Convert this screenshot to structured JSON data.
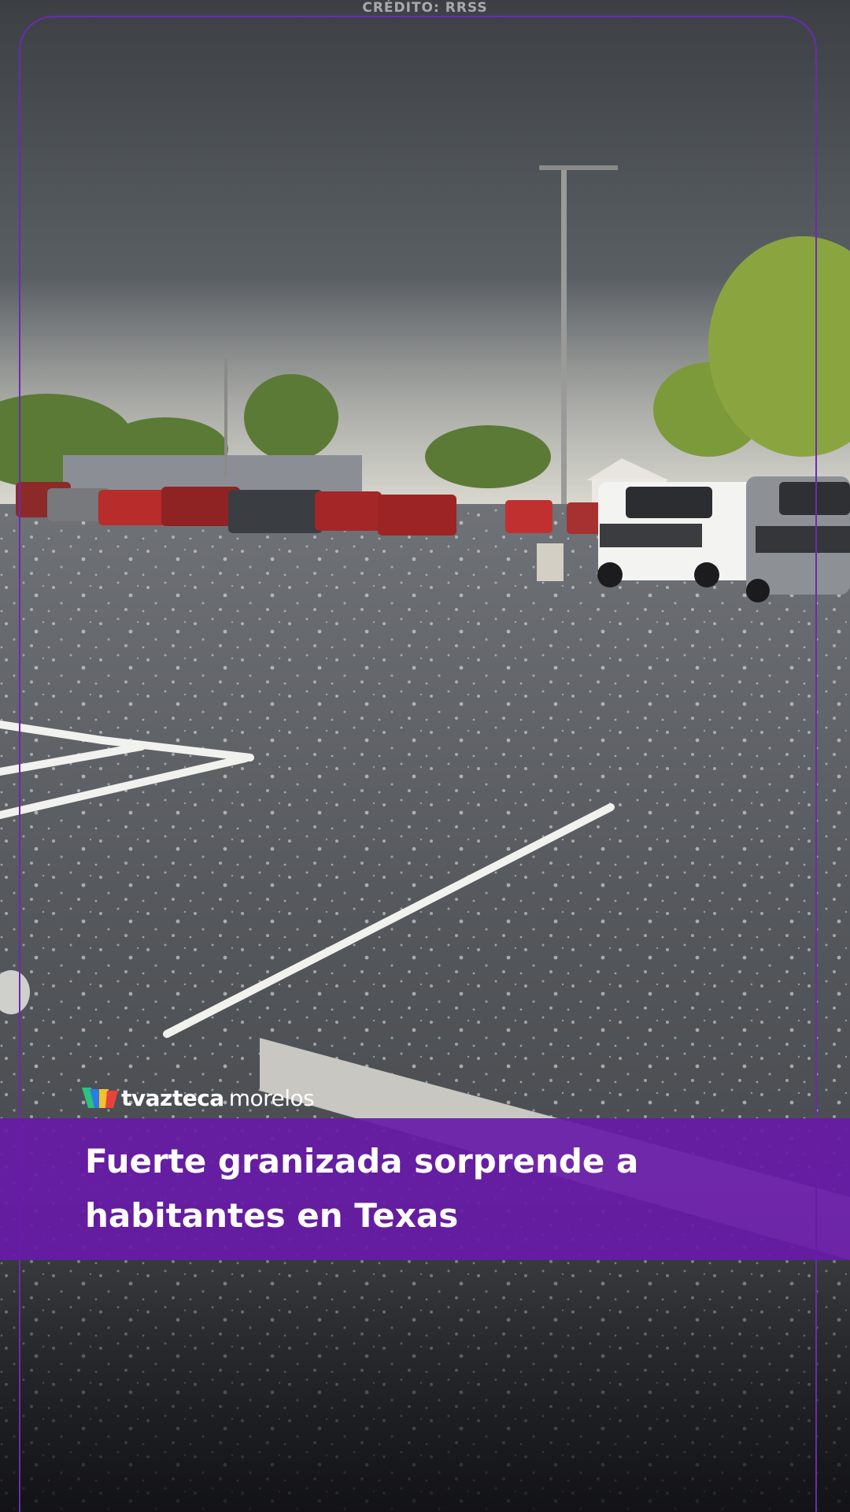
{
  "credit": "CRÉDITO: RRSS",
  "logo": {
    "brand": "tvazteca",
    "region": "morelos",
    "mark_icon": "tv-azteca-logo-mark",
    "colors": [
      "#2ec27e",
      "#2a7de1",
      "#f2c230",
      "#e8423a"
    ]
  },
  "headline": "Fuerte granizada sorprende a habitantes en Texas",
  "accent_color": "#681aa8"
}
